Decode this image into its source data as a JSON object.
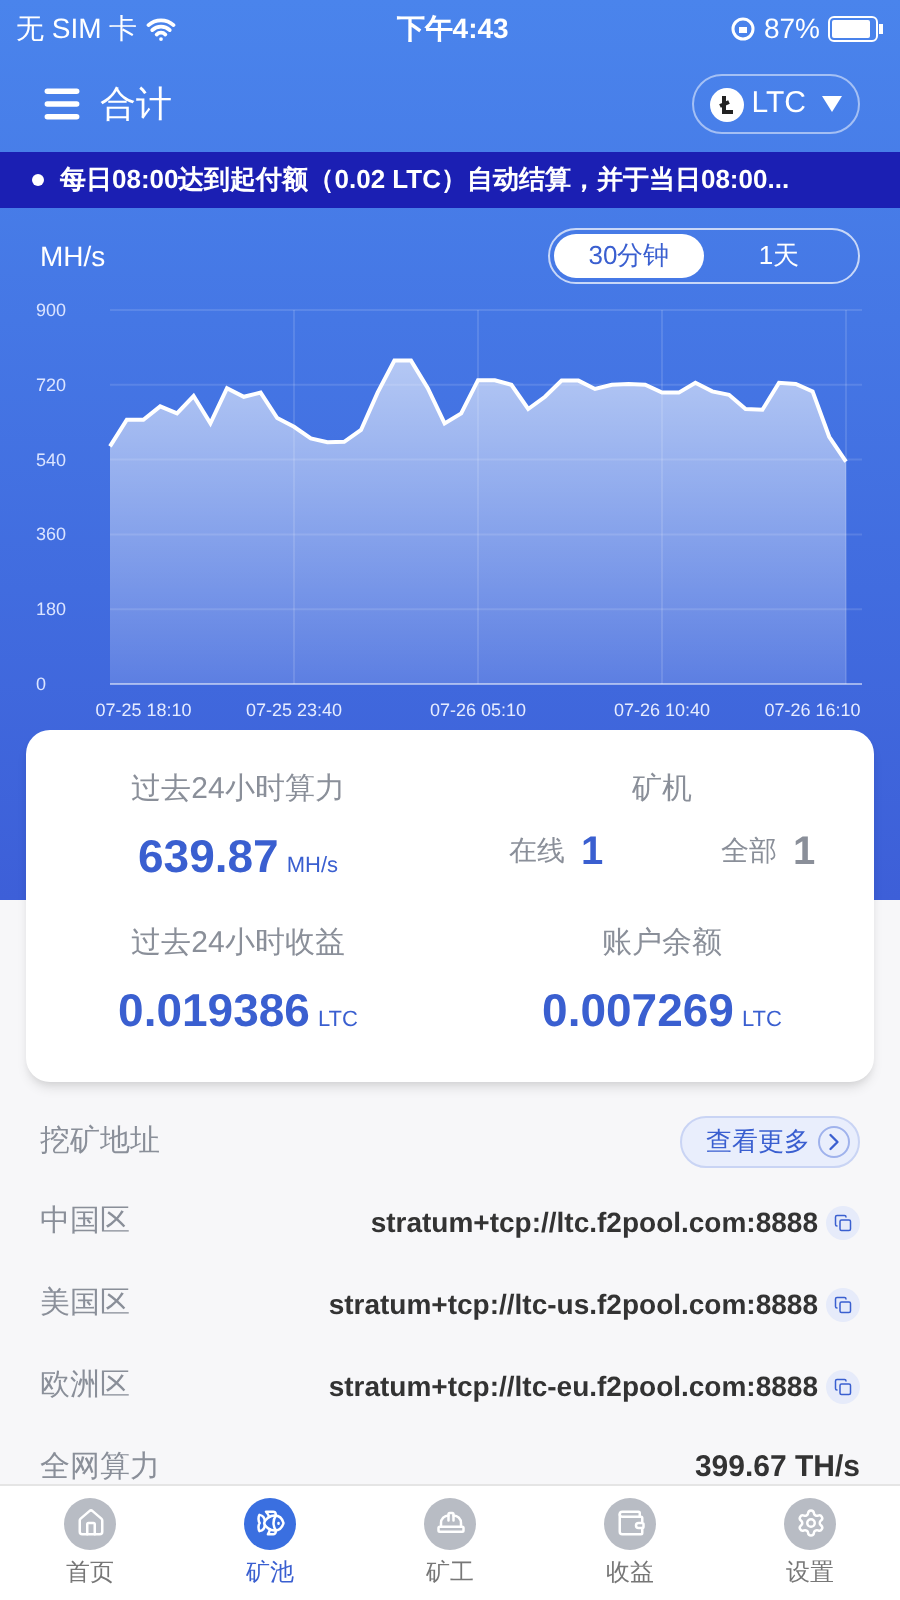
{
  "status_bar": {
    "carrier": "无 SIM 卡",
    "time": "下午4:43",
    "battery": "87%"
  },
  "header": {
    "title": "合计",
    "coin": "LTC"
  },
  "notice": "每日08:00达到起付额（0.02 LTC）自动结算，并于当日08:00...",
  "chart_panel": {
    "ranges": [
      {
        "label": "30分钟",
        "selected": true
      },
      {
        "label": "1天",
        "selected": false
      }
    ],
    "chart_data": {
      "type": "area",
      "ylabel": "MH/s",
      "categories": [
        null,
        null,
        "07-25 18:10",
        null,
        null,
        null,
        null,
        null,
        null,
        null,
        null,
        "07-25 23:40",
        null,
        null,
        null,
        null,
        null,
        null,
        null,
        null,
        null,
        null,
        "07-26 05:10",
        null,
        null,
        null,
        null,
        null,
        null,
        null,
        null,
        null,
        null,
        "07-26 10:40",
        null,
        null,
        null,
        null,
        null,
        null,
        null,
        null,
        "07-26 16:10",
        null,
        null
      ],
      "ylim": [
        0,
        900
      ],
      "grid": true,
      "yticks": [
        0,
        180,
        360,
        540,
        720,
        900
      ],
      "series": [
        {
          "color": "#ffffff",
          "values": [
            572,
            636,
            636,
            668,
            651,
            693,
            627,
            712,
            691,
            701,
            640,
            619,
            591,
            582,
            583,
            611,
            701,
            778,
            778,
            712,
            627,
            651,
            731,
            731,
            720,
            662,
            691,
            730,
            730,
            710,
            720,
            722,
            720,
            701,
            701,
            725,
            704,
            696,
            662,
            660,
            725,
            722,
            704,
            595,
            535
          ]
        }
      ]
    }
  },
  "stats": {
    "hashrate": {
      "label": "过去24小时算力",
      "value": "639.87",
      "unit": "MH/s"
    },
    "miners": {
      "label": "矿机",
      "online_label": "在线",
      "online": "1",
      "total_label": "全部",
      "total": "1"
    },
    "income": {
      "label": "过去24小时收益",
      "value": "0.019386",
      "unit": "LTC"
    },
    "balance": {
      "label": "账户余额",
      "value": "0.007269",
      "unit": "LTC"
    }
  },
  "addresses": {
    "title": "挖矿地址",
    "more": "查看更多",
    "rows": [
      {
        "region": "中国区",
        "url": "stratum+tcp://ltc.f2pool.com:8888"
      },
      {
        "region": "美国区",
        "url": "stratum+tcp://ltc-us.f2pool.com:8888"
      },
      {
        "region": "欧洲区",
        "url": "stratum+tcp://ltc-eu.f2pool.com:8888"
      }
    ]
  },
  "network": {
    "label": "全网算力",
    "value": "399.67 TH/s"
  },
  "tab_bar": [
    {
      "label": "首页",
      "kind": "home",
      "selected": false
    },
    {
      "label": "矿池",
      "kind": "pool",
      "selected": true
    },
    {
      "label": "矿工",
      "kind": "worker",
      "selected": false
    },
    {
      "label": "收益",
      "kind": "wallet",
      "selected": false
    },
    {
      "label": "设置",
      "kind": "settings",
      "selected": false
    }
  ]
}
